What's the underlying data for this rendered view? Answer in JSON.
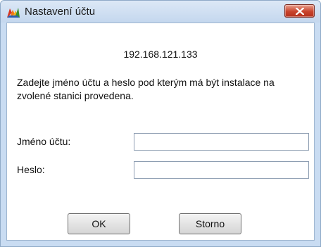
{
  "window": {
    "title": "Nastavení účtu",
    "app_icon": "avg-logo-icon",
    "close_icon": "close-icon"
  },
  "dialog": {
    "ip_address": "192.168.121.133",
    "message": "Zadejte jméno účtu a heslo pod kterým má být instalace na zvolené stanici provedena.",
    "account_label": "Jméno účtu:",
    "account_value": "",
    "password_label": "Heslo:",
    "password_value": "",
    "ok_label": "OK",
    "cancel_label": "Storno"
  },
  "colors": {
    "frame": "#c9dcf2",
    "close_button": "#c9442d"
  }
}
